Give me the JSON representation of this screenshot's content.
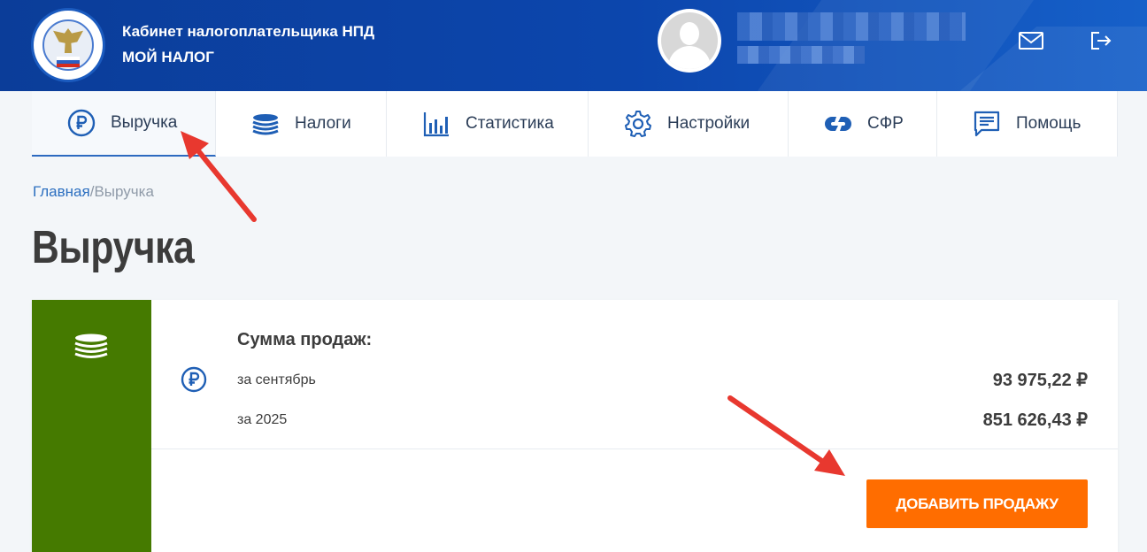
{
  "header": {
    "line1": "Кабинет налогоплательщика НПД",
    "line2": "МОЙ НАЛОГ"
  },
  "nav": {
    "items": [
      {
        "label": "Выручка",
        "icon": "ruble-circle-icon"
      },
      {
        "label": "Налоги",
        "icon": "coins-stack-icon"
      },
      {
        "label": "Статистика",
        "icon": "bar-chart-icon"
      },
      {
        "label": "Настройки",
        "icon": "gear-icon"
      },
      {
        "label": "СФР",
        "icon": "sfr-logo-icon"
      },
      {
        "label": "Помощь",
        "icon": "help-chat-icon"
      }
    ],
    "active": "Выручка"
  },
  "breadcrumb": {
    "home": "Главная",
    "separator": "/",
    "current": "Выручка"
  },
  "page": {
    "title": "Выручка"
  },
  "sales": {
    "title": "Сумма продаж:",
    "rows": [
      {
        "label": "за сентябрь",
        "value": "93 975,22 ₽"
      },
      {
        "label": "за 2025",
        "value": "851 626,43 ₽"
      }
    ],
    "add_button": "ДОБАВИТЬ ПРОДАЖУ"
  },
  "colors": {
    "header_blue": "#0c46ad",
    "side_green": "#457a00",
    "button_orange": "#ff6d00",
    "link_blue": "#2c6fc0",
    "annotation_red": "#e8382f"
  }
}
